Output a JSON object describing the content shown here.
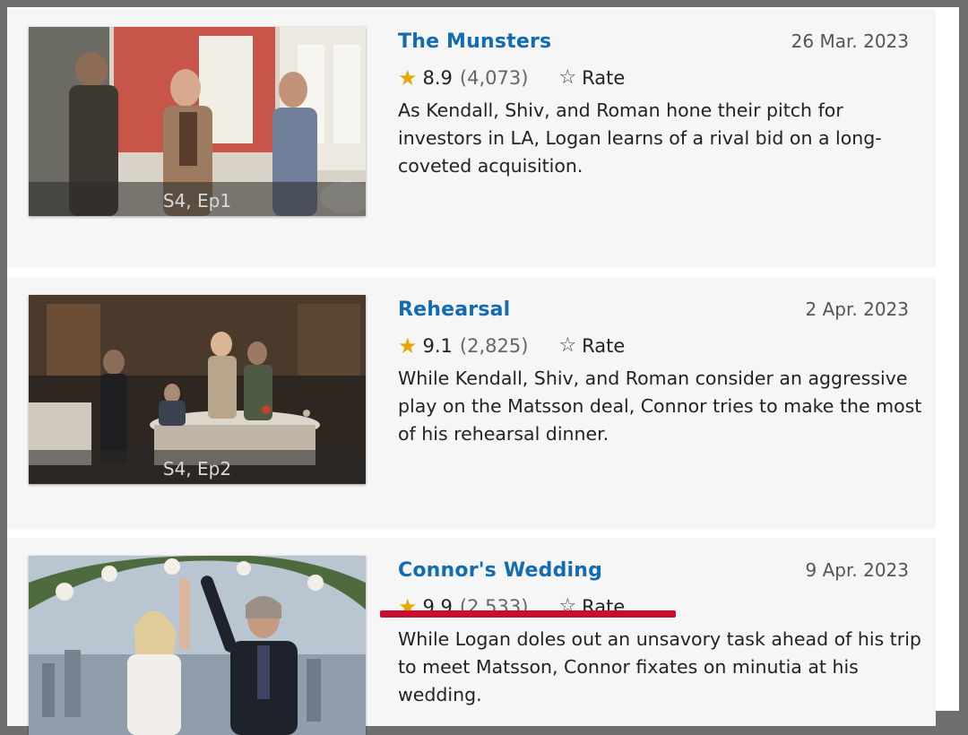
{
  "episodes": [
    {
      "title": "The Munsters",
      "date": "26 Mar. 2023",
      "rating": "8.9",
      "votes": "(4,073)",
      "rate_label": "Rate",
      "episode_label": "S4, Ep1",
      "description": "As Kendall, Shiv, and Roman hone their pitch for investors in LA, Logan learns of a rival bid on a long-coveted acquisition."
    },
    {
      "title": "Rehearsal",
      "date": "2 Apr. 2023",
      "rating": "9.1",
      "votes": "(2,825)",
      "rate_label": "Rate",
      "episode_label": "S4, Ep2",
      "description": "While Kendall, Shiv, and Roman consider an aggressive play on the Matsson deal, Connor tries to make the most of his rehearsal dinner."
    },
    {
      "title": "Connor's Wedding",
      "date": "9 Apr. 2023",
      "rating": "9.9",
      "votes": "(2,533)",
      "rate_label": "Rate",
      "description": "While Logan doles out an unsavory task ahead of his trip to meet Matsson, Connor fixates on minutia at his wedding."
    }
  ],
  "icons": {
    "rating_star": "star-filled-icon",
    "rate_star": "star-outline-icon"
  },
  "colors": {
    "title": "#136cb2",
    "star": "#e6a700",
    "highlight_underline": "#c8102e"
  }
}
